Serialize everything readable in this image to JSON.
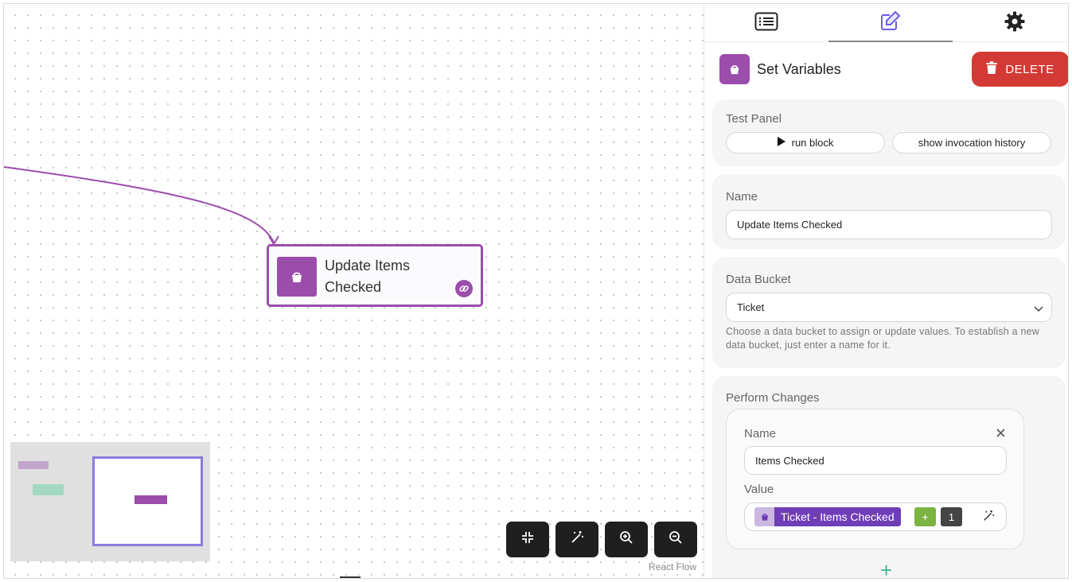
{
  "canvas": {
    "node": {
      "title": "Update Items Checked",
      "icon": "bucket-icon",
      "link_icon": "link-icon",
      "color": "#9b4dab"
    },
    "minimap": {
      "node_colors": [
        "#c2a5cf",
        "#a3d8c2",
        "#9b4dab"
      ],
      "viewport_color": "#8a7be0"
    },
    "controls": [
      {
        "name": "fit-view-button",
        "icon": "compress-icon"
      },
      {
        "name": "auto-layout-button",
        "icon": "magic-wand-icon"
      },
      {
        "name": "zoom-in-button",
        "icon": "zoom-in-icon"
      },
      {
        "name": "zoom-out-button",
        "icon": "zoom-out-icon"
      }
    ],
    "attribution": "React Flow"
  },
  "panel": {
    "tabs": [
      {
        "name": "tab-list",
        "icon": "list-icon",
        "active": false
      },
      {
        "name": "tab-edit",
        "icon": "edit-icon",
        "active": true
      },
      {
        "name": "tab-settings",
        "icon": "gear-icon",
        "active": false
      }
    ],
    "header": {
      "title": "Set Variables",
      "icon": "bucket-icon",
      "delete_label": "DELETE"
    },
    "test_panel": {
      "label": "Test Panel",
      "run_label": "run block",
      "history_label": "show invocation history"
    },
    "name_field": {
      "label": "Name",
      "value": "Update Items Checked"
    },
    "data_bucket": {
      "label": "Data Bucket",
      "value": "Ticket",
      "help": "Choose a data bucket to assign or update values. To establish a new data bucket, just enter a name for it."
    },
    "perform_changes": {
      "label": "Perform Changes",
      "items": [
        {
          "name_label": "Name",
          "name_value": "Items Checked",
          "value_label": "Value",
          "chip_text": "Ticket - Items Checked",
          "plus_label": "+",
          "number": "1"
        }
      ]
    },
    "add_label": "+"
  },
  "colors": {
    "accent": "#9b4dab",
    "danger": "#d43a35",
    "chip": "#6f3db8",
    "plus": "#7cb342",
    "add": "#3fb98a"
  }
}
